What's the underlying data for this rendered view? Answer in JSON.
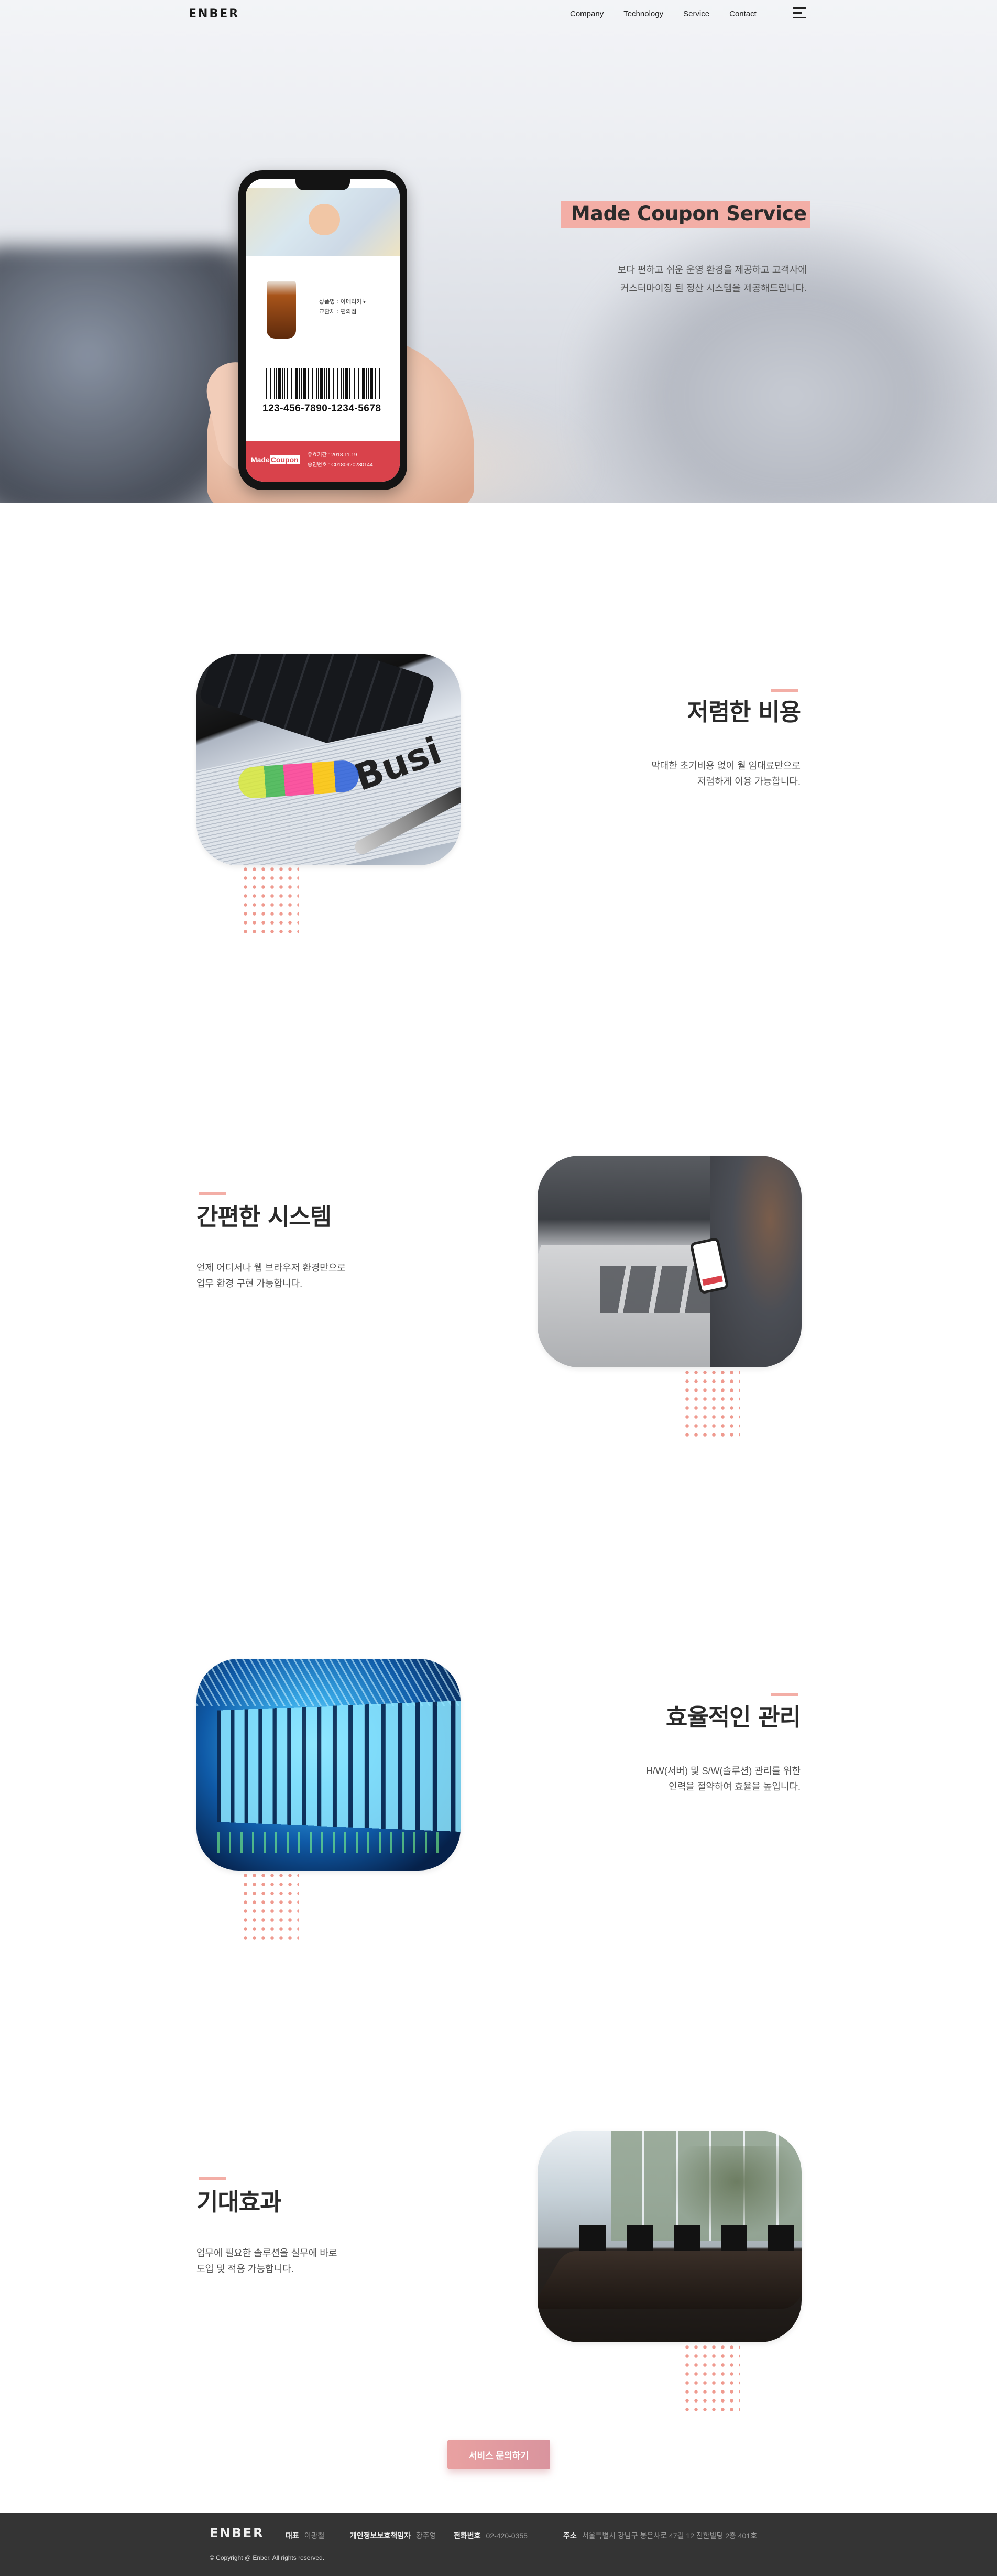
{
  "header": {
    "logo": "ENBER",
    "nav": [
      "Company",
      "Technology",
      "Service",
      "Contact"
    ]
  },
  "hero": {
    "title": "Made Coupon Service",
    "desc_line1": "보다 편하고 쉬운 운영 환경을 제공하고 고객사에",
    "desc_line2": "커스터마이징 된 정산 시스템을 제공해드립니다.",
    "coupon": {
      "product": "상품명 : 아메리카노",
      "store": "교환처 : 편의점",
      "barcode_number": "123-456-7890-1234-5678",
      "brand_left": "Made",
      "brand_right": "Coupon",
      "expiry": "유효기간 : 2018.11.19",
      "approval": "승인번호 : C0180920230144"
    }
  },
  "features": [
    {
      "title": "저렴한 비용",
      "line1": "막대한 초기비용 없이 월 임대료만으로",
      "line2": "저렴하게 이용 가능합니다.",
      "image_word": "Busi"
    },
    {
      "title": "간편한 시스템",
      "line1": "언제 어디서나 웹 브라우저 환경만으로",
      "line2": "업무 환경 구현 가능합니다."
    },
    {
      "title": "효율적인 관리",
      "line1": "H/W(서버) 및 S/W(솔루션) 관리를 위한",
      "line2": "인력을 절약하여 효율을 높입니다."
    },
    {
      "title": "기대효과",
      "line1": "업무에 필요한 솔루션을 실무에 바로",
      "line2": "도입 및 적용 가능합니다."
    }
  ],
  "cta": {
    "label": "서비스 문의하기"
  },
  "footer": {
    "logo": "ENBER",
    "ceo_label": "대표",
    "ceo": "이광철",
    "privacy_label": "개인정보보호책임자",
    "privacy": "황주영",
    "phone_label": "전화번호",
    "phone": "02-420-0355",
    "addr_label": "주소",
    "addr": "서울특별시 강남구 봉은사로 47길 12 진한빌딩 2층 401호",
    "copyright": "© Copyright @ Enber. All rights reserved."
  },
  "colors": {
    "accent": "#f3aea6",
    "dots": "#ef9a8f",
    "footer_bg": "#343434",
    "cta": "#e9a1a1"
  }
}
